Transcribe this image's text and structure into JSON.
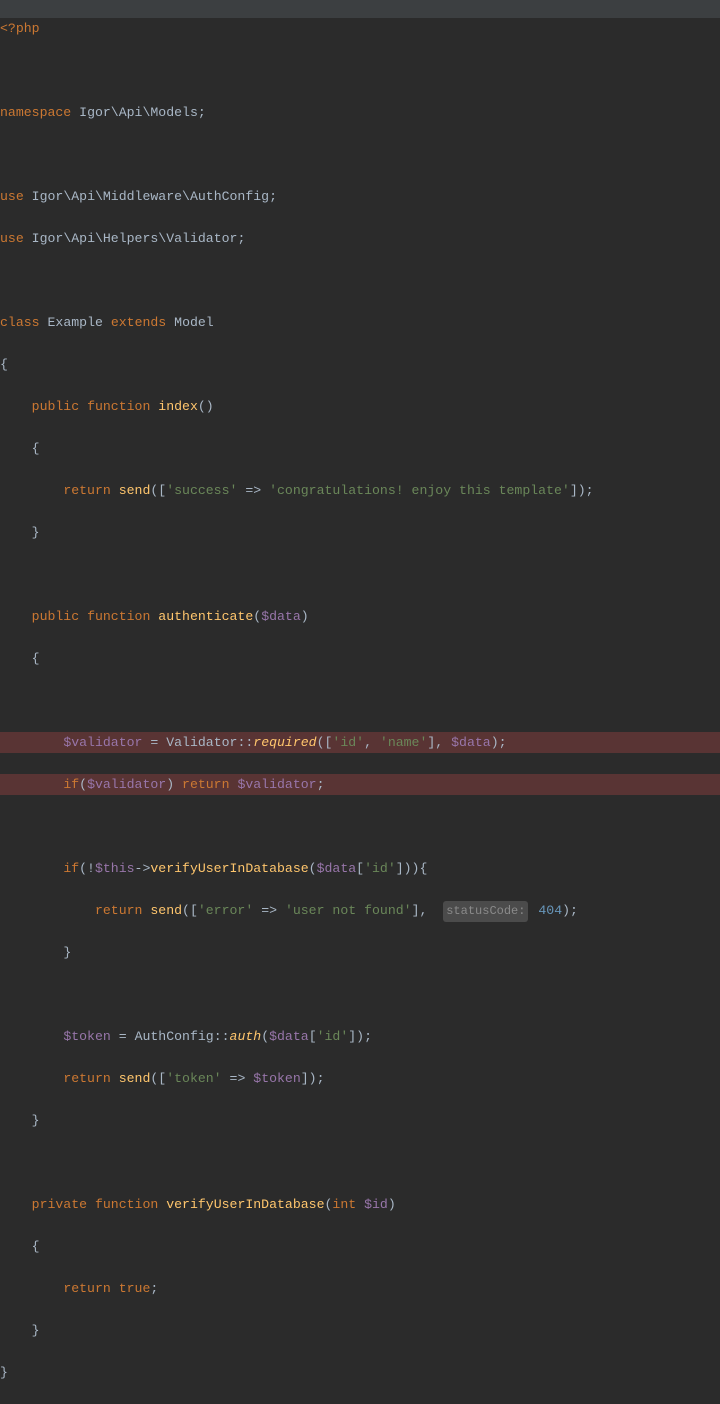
{
  "opentag": "<?php",
  "ns": {
    "kw": "namespace",
    "path": "Igor\\Api\\Models"
  },
  "use1": {
    "kw": "use",
    "path": "Igor\\Api\\Middleware\\AuthConfig"
  },
  "use2": {
    "kw": "use",
    "path": "Igor\\Api\\Helpers\\Validator"
  },
  "cls": {
    "kw1": "class",
    "name": "Example",
    "kw2": "extends",
    "parent": "Model"
  },
  "kw": {
    "public": "public",
    "private": "private",
    "function": "function",
    "return": "return",
    "int": "int",
    "if": "if",
    "true": "true"
  },
  "fn1": {
    "name": "index"
  },
  "fn2": {
    "name": "authenticate"
  },
  "fn3": {
    "name": "verifyUserInDatabase"
  },
  "call": {
    "send": "send",
    "required": "required",
    "auth": "auth",
    "validator": "Validator",
    "authconfig": "AuthConfig"
  },
  "str": {
    "success": "'success'",
    "congrats": "'congratulations! enjoy this template'",
    "id": "'id'",
    "name": "'name'",
    "error": "'error'",
    "unf": "'user not found'",
    "token": "'token'"
  },
  "var": {
    "data": "$data",
    "validator": "$validator",
    "this": "$this",
    "token": "$token",
    "id": "$id"
  },
  "hint": {
    "statusCode": "statusCode:"
  },
  "num": {
    "n404": "404"
  }
}
